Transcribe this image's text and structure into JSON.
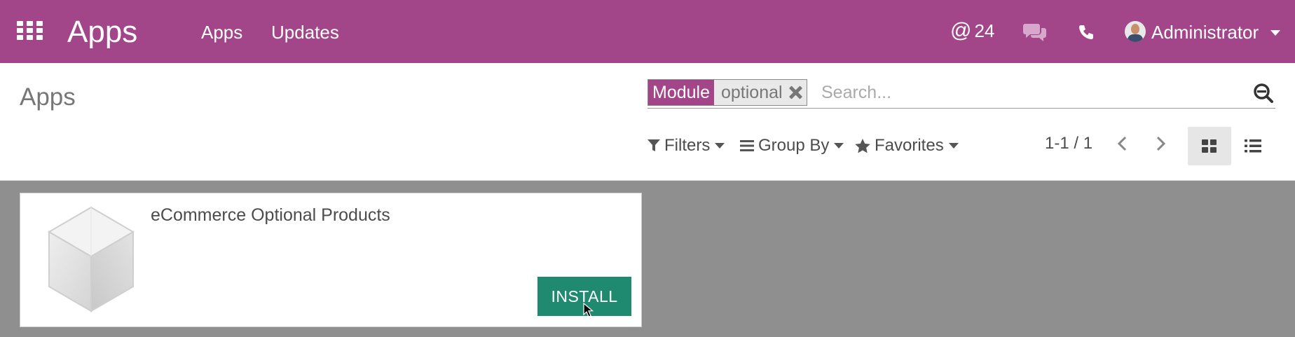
{
  "navbar": {
    "app_title": "Apps",
    "menu": [
      "Apps",
      "Updates"
    ],
    "mentions_symbol": "@",
    "mentions_count": "24",
    "user_name": "Administrator"
  },
  "control_panel": {
    "breadcrumb": "Apps",
    "search": {
      "facet_label": "Module",
      "facet_value": "optional",
      "placeholder": "Search..."
    },
    "filters_label": "Filters",
    "group_by_label": "Group By",
    "favorites_label": "Favorites",
    "pager": "1-1 / 1"
  },
  "modules": [
    {
      "name": "eCommerce Optional Products",
      "action_label": "INSTALL"
    }
  ],
  "colors": {
    "brand": "#a24689",
    "install": "#1f8a70"
  }
}
